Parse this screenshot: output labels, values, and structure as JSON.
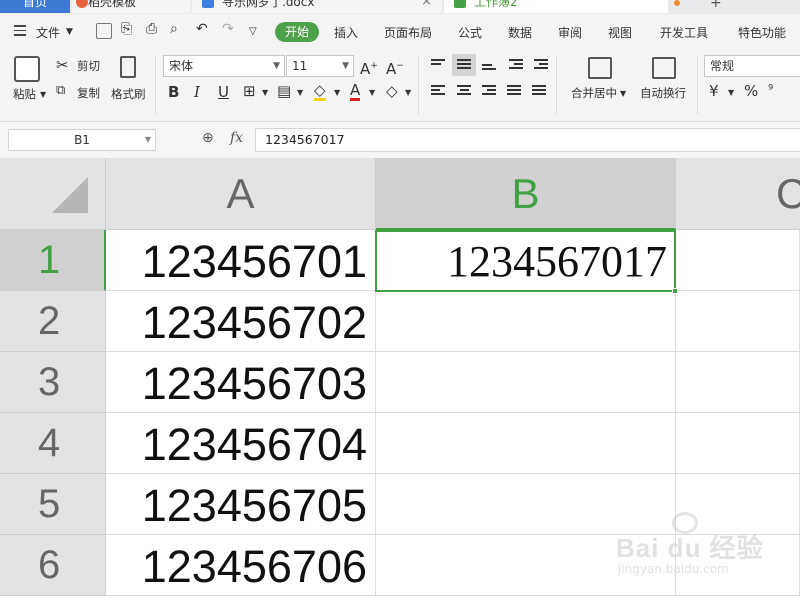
{
  "tabs": {
    "home": "首页",
    "doc1": "稻壳模板",
    "doc2": "寻乐网罗了.docx",
    "doc3": "工作簿2",
    "close_glyph": "×",
    "new_tab_glyph": "+"
  },
  "menu": {
    "file": "文件",
    "start": "开始",
    "insert": "插入",
    "page_layout": "页面布局",
    "formula": "公式",
    "data": "数据",
    "review": "审阅",
    "view": "视图",
    "developer": "开发工具",
    "special": "特色功能"
  },
  "ribbon": {
    "paste": "粘贴",
    "cut": "剪切",
    "copy": "复制",
    "format_painter": "格式刷",
    "font_name": "宋体",
    "font_size": "11",
    "merge_center": "合并居中",
    "wrap_text": "自动换行",
    "number_format": "常规"
  },
  "formula_bar": {
    "cell_ref": "B1",
    "fx": "fx",
    "value": "1234567017"
  },
  "columns": [
    "A",
    "B",
    "C"
  ],
  "rows": [
    {
      "num": "1",
      "a": "123456701",
      "b": "1234567017"
    },
    {
      "num": "2",
      "a": "123456702",
      "b": ""
    },
    {
      "num": "3",
      "a": "123456703",
      "b": ""
    },
    {
      "num": "4",
      "a": "123456704",
      "b": ""
    },
    {
      "num": "5",
      "a": "123456705",
      "b": ""
    },
    {
      "num": "6",
      "a": "123456706",
      "b": ""
    }
  ],
  "watermark": {
    "brand": "Bai du 经验",
    "url": "jingyan.baidu.com"
  },
  "colors": {
    "accent_green": "#43a047",
    "tab_blue": "#3e7bd6"
  }
}
